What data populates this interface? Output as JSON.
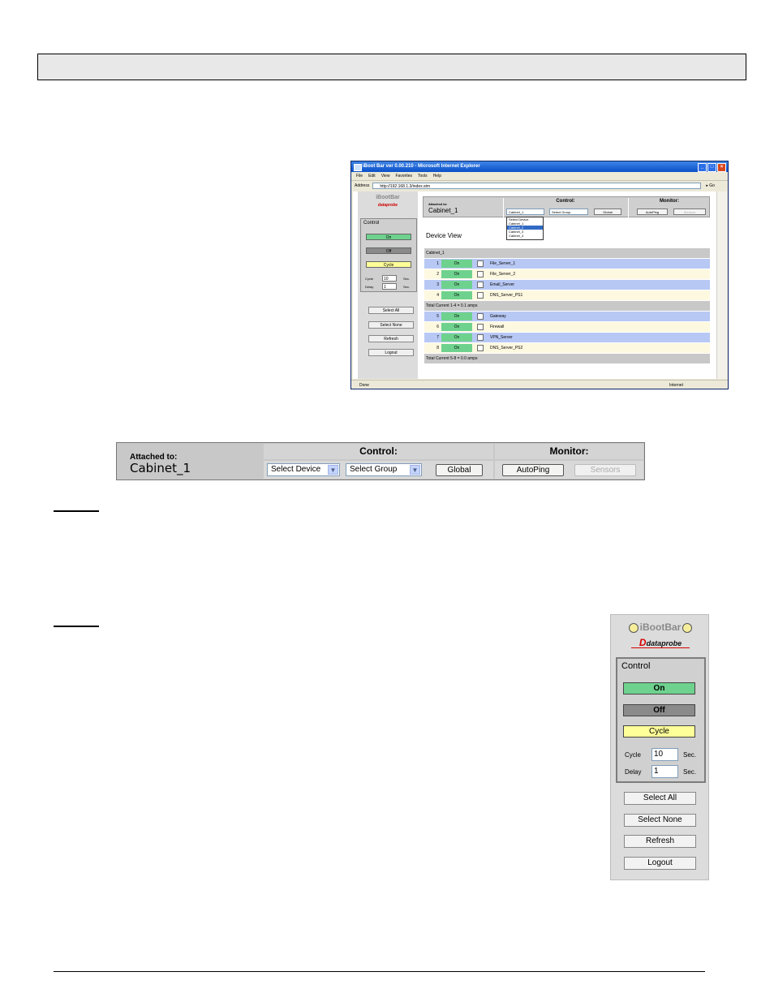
{
  "browser": {
    "title": "iBoot Bar ver 0.00.210 - Microsoft Internet Explorer",
    "menu": [
      "File",
      "Edit",
      "View",
      "Favorites",
      "Tools",
      "Help"
    ],
    "address_label": "Address",
    "address_value": "http://192.168.1.3/index.stm",
    "go_label": "Go",
    "status_text": "Done",
    "zone_text": "Internet"
  },
  "app": {
    "brand": "iBootBar",
    "maker": "dataprobe",
    "attached_label": "Attached to:",
    "attached_value": "Cabinet_1",
    "control_header": "Control:",
    "monitor_header": "Monitor:",
    "select_device_mini": "Cabinet_1",
    "select_device": "Select Device",
    "select_group": "Select Group",
    "global_btn": "Global",
    "autoping_btn": "AutoPing",
    "sensors_btn": "Sensors",
    "device_dropdown_options": [
      "Select Device",
      "Cabinet_1",
      "Cabinet_2",
      "Cabinet_3",
      "Cabinet_4"
    ],
    "device_view_title": "Device View"
  },
  "nav": {
    "control_title": "Control",
    "on_btn": "On",
    "off_btn": "Off",
    "cycle_btn": "Cycle",
    "cycle_label": "Cycle",
    "cycle_value": "10",
    "delay_label": "Delay",
    "delay_value": "1",
    "sec_unit": "Sec.",
    "select_all": "Select All",
    "select_none": "Select None",
    "refresh": "Refresh",
    "logout": "Logout"
  },
  "device_table": {
    "group": "Cabinet_1",
    "outlets": [
      {
        "num": "1",
        "state": "On",
        "name": "File_Server_1"
      },
      {
        "num": "2",
        "state": "On",
        "name": "File_Server_2"
      },
      {
        "num": "3",
        "state": "On",
        "name": "Email_Server"
      },
      {
        "num": "4",
        "state": "On",
        "name": "DNS_Server_PS1"
      },
      {
        "num": "5",
        "state": "On",
        "name": "Gateway"
      },
      {
        "num": "6",
        "state": "On",
        "name": "Firewall"
      },
      {
        "num": "7",
        "state": "On",
        "name": "VPN_Server"
      },
      {
        "num": "8",
        "state": "On",
        "name": "DNS_Server_PS2"
      }
    ],
    "total_1_4": "Total Current 1-4 = 0.1 amps",
    "total_5_8": "Total Current 5-8 = 0.0 amps"
  },
  "colors": {
    "on_green": "#6ed28e",
    "off_gray": "#8a8a8a",
    "cycle_yellow": "#ffff99",
    "row_blue": "#b8c8f4",
    "row_cream": "#fdf8e0"
  }
}
